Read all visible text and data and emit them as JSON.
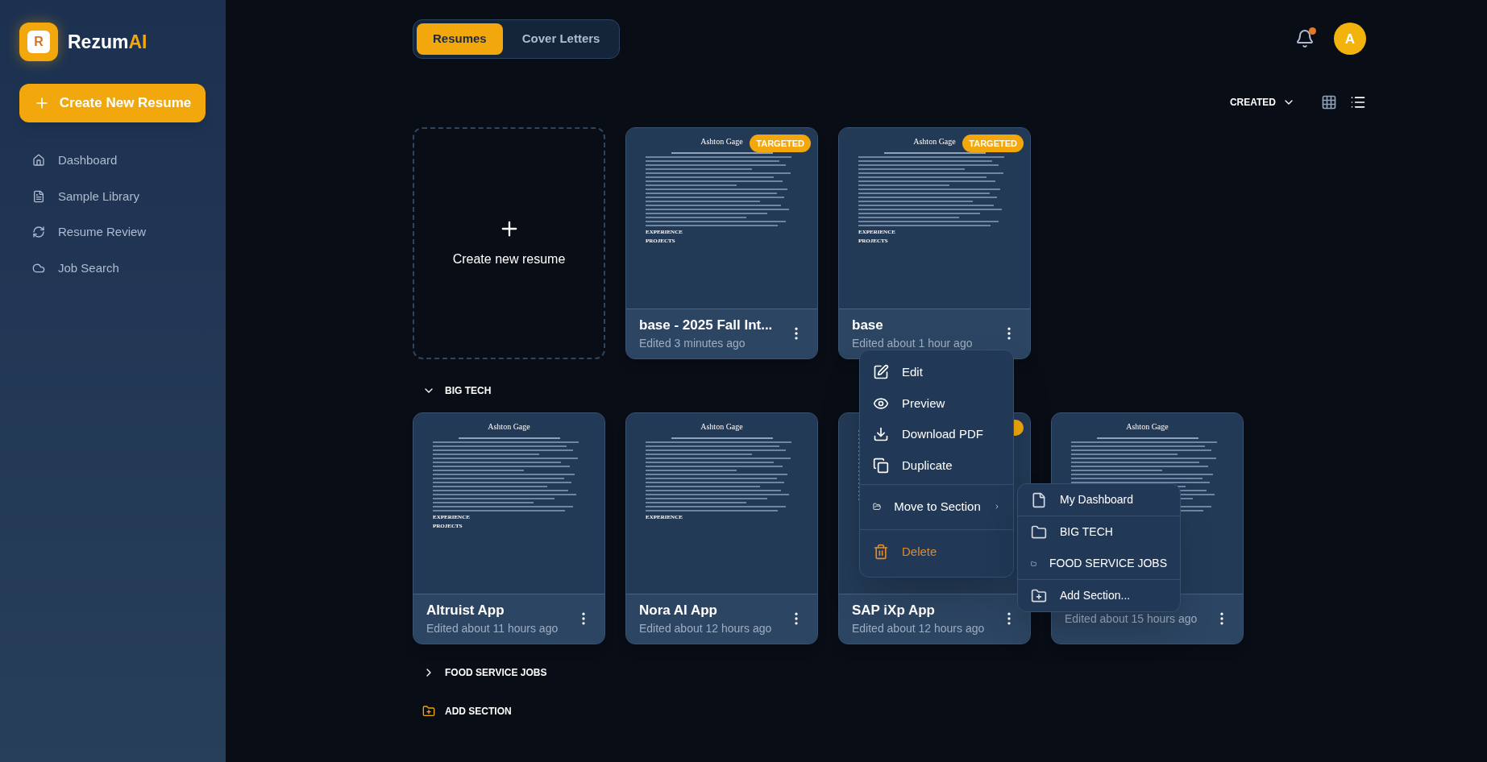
{
  "brand": {
    "logo_letter": "R",
    "name": "Rezum",
    "name_accent": "AI"
  },
  "create_button": {
    "label": "Create New Resume"
  },
  "nav": [
    {
      "label": "Dashboard"
    },
    {
      "label": "Sample Library"
    },
    {
      "label": "Resume Review"
    },
    {
      "label": "Job Search"
    }
  ],
  "tabs": [
    {
      "label": "Resumes",
      "selected": true
    },
    {
      "label": "Cover Letters",
      "selected": false
    }
  ],
  "notifications": {
    "unread": true
  },
  "avatar": {
    "initial": "A"
  },
  "sort": {
    "label": "CREATED"
  },
  "create_card": {
    "label": "Create new resume"
  },
  "resumes": [
    {
      "title": "base - 2025 Fall Int...",
      "edited": "Edited 3 minutes ago",
      "targeted": true,
      "badge": "TARGETED",
      "preview": {
        "name": "Ashton Gage",
        "headings": [
          "EXPERIENCE",
          "PROJECTS"
        ]
      }
    },
    {
      "title": "base",
      "edited": "Edited about 1 hour ago",
      "targeted": true,
      "badge": "TARGETED",
      "preview": {
        "name": "Ashton Gage",
        "headings": [
          "EXPERIENCE",
          "PROJECTS"
        ]
      }
    }
  ],
  "sections": [
    {
      "name": "BIG TECH",
      "expanded": true,
      "resumes": [
        {
          "title": "Altruist App",
          "edited": "Edited about 11 hours ago",
          "targeted": false,
          "preview": {
            "name": "Ashton Gage",
            "headings": [
              "EXPERIENCE",
              "PROJECTS"
            ]
          }
        },
        {
          "title": "Nora AI App",
          "edited": "Edited about 12 hours ago",
          "targeted": false,
          "preview": {
            "name": "Ashton Gage",
            "headings": [
              "EXPERIENCE"
            ]
          }
        },
        {
          "title": "SAP iXp App",
          "edited": "Edited about 12 hours ago",
          "targeted": true
        },
        {
          "edited": "Edited about 15 hours ago",
          "targeted": false,
          "preview": {
            "name": "Ashton Gage"
          }
        }
      ]
    },
    {
      "name": "FOOD SERVICE JOBS",
      "expanded": false
    }
  ],
  "add_section": {
    "label": "ADD SECTION"
  },
  "context_menu": {
    "items": [
      {
        "label": "Edit",
        "kind": "edit"
      },
      {
        "label": "Preview",
        "kind": "preview"
      },
      {
        "label": "Download PDF",
        "kind": "download"
      },
      {
        "label": "Duplicate",
        "kind": "duplicate"
      },
      {
        "label": "Move to Section",
        "kind": "submenu"
      },
      {
        "label": "Delete",
        "kind": "danger"
      }
    ]
  },
  "submenu": {
    "items": [
      {
        "label": "My Dashboard",
        "kind": "dashboard"
      },
      {
        "label": "BIG TECH",
        "kind": "folder"
      },
      {
        "label": "FOOD SERVICE JOBS",
        "kind": "folder"
      },
      {
        "label": "Add Section...",
        "kind": "add"
      }
    ]
  }
}
